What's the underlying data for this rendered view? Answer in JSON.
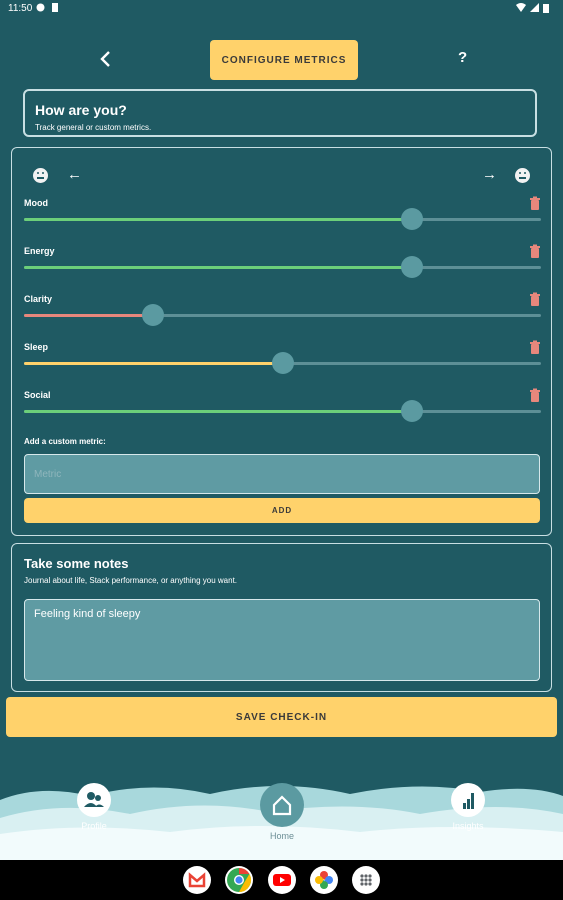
{
  "status_bar": {
    "time": "11:50"
  },
  "header": {
    "title": "CONFIGURE METRICS",
    "help": "?"
  },
  "intro": {
    "title": "How are you?",
    "subtitle": "Track general or custom metrics."
  },
  "metrics": [
    {
      "label": "Mood",
      "value": 0.75,
      "color": "#6ccf7a"
    },
    {
      "label": "Energy",
      "value": 0.75,
      "color": "#6ccf7a"
    },
    {
      "label": "Clarity",
      "value": 0.25,
      "color": "#e7877c"
    },
    {
      "label": "Sleep",
      "value": 0.5,
      "color": "#ffd26b"
    },
    {
      "label": "Social",
      "value": 0.75,
      "color": "#6ccf7a"
    }
  ],
  "custom_metric": {
    "label": "Add a custom metric:",
    "placeholder": "Metric",
    "add_label": "ADD"
  },
  "notes": {
    "title": "Take some notes",
    "subtitle": "Journal about life, Stack performance, or anything you want.",
    "value": "Feeling kind of sleepy"
  },
  "save_label": "SAVE CHECK-IN",
  "bottom_nav": {
    "profile": "Profile",
    "home": "Home",
    "insights": "Insights"
  },
  "colors": {
    "background": "#1f5a63",
    "accent": "#ffd26b",
    "trash": "#e7877c"
  }
}
